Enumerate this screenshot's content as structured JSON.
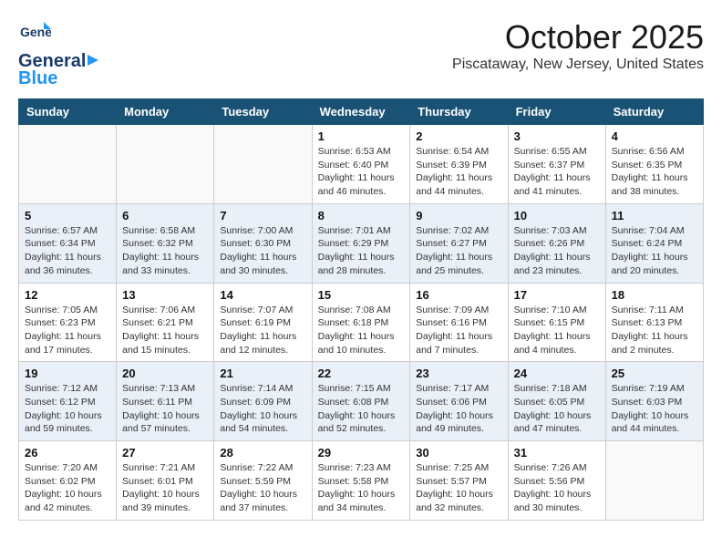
{
  "header": {
    "logo_line1": "General",
    "logo_line2": "Blue",
    "month_title": "October 2025",
    "location": "Piscataway, New Jersey, United States"
  },
  "weekdays": [
    "Sunday",
    "Monday",
    "Tuesday",
    "Wednesday",
    "Thursday",
    "Friday",
    "Saturday"
  ],
  "weeks": [
    [
      {
        "day": "",
        "info": ""
      },
      {
        "day": "",
        "info": ""
      },
      {
        "day": "",
        "info": ""
      },
      {
        "day": "1",
        "info": "Sunrise: 6:53 AM\nSunset: 6:40 PM\nDaylight: 11 hours\nand 46 minutes."
      },
      {
        "day": "2",
        "info": "Sunrise: 6:54 AM\nSunset: 6:39 PM\nDaylight: 11 hours\nand 44 minutes."
      },
      {
        "day": "3",
        "info": "Sunrise: 6:55 AM\nSunset: 6:37 PM\nDaylight: 11 hours\nand 41 minutes."
      },
      {
        "day": "4",
        "info": "Sunrise: 6:56 AM\nSunset: 6:35 PM\nDaylight: 11 hours\nand 38 minutes."
      }
    ],
    [
      {
        "day": "5",
        "info": "Sunrise: 6:57 AM\nSunset: 6:34 PM\nDaylight: 11 hours\nand 36 minutes."
      },
      {
        "day": "6",
        "info": "Sunrise: 6:58 AM\nSunset: 6:32 PM\nDaylight: 11 hours\nand 33 minutes."
      },
      {
        "day": "7",
        "info": "Sunrise: 7:00 AM\nSunset: 6:30 PM\nDaylight: 11 hours\nand 30 minutes."
      },
      {
        "day": "8",
        "info": "Sunrise: 7:01 AM\nSunset: 6:29 PM\nDaylight: 11 hours\nand 28 minutes."
      },
      {
        "day": "9",
        "info": "Sunrise: 7:02 AM\nSunset: 6:27 PM\nDaylight: 11 hours\nand 25 minutes."
      },
      {
        "day": "10",
        "info": "Sunrise: 7:03 AM\nSunset: 6:26 PM\nDaylight: 11 hours\nand 23 minutes."
      },
      {
        "day": "11",
        "info": "Sunrise: 7:04 AM\nSunset: 6:24 PM\nDaylight: 11 hours\nand 20 minutes."
      }
    ],
    [
      {
        "day": "12",
        "info": "Sunrise: 7:05 AM\nSunset: 6:23 PM\nDaylight: 11 hours\nand 17 minutes."
      },
      {
        "day": "13",
        "info": "Sunrise: 7:06 AM\nSunset: 6:21 PM\nDaylight: 11 hours\nand 15 minutes."
      },
      {
        "day": "14",
        "info": "Sunrise: 7:07 AM\nSunset: 6:19 PM\nDaylight: 11 hours\nand 12 minutes."
      },
      {
        "day": "15",
        "info": "Sunrise: 7:08 AM\nSunset: 6:18 PM\nDaylight: 11 hours\nand 10 minutes."
      },
      {
        "day": "16",
        "info": "Sunrise: 7:09 AM\nSunset: 6:16 PM\nDaylight: 11 hours\nand 7 minutes."
      },
      {
        "day": "17",
        "info": "Sunrise: 7:10 AM\nSunset: 6:15 PM\nDaylight: 11 hours\nand 4 minutes."
      },
      {
        "day": "18",
        "info": "Sunrise: 7:11 AM\nSunset: 6:13 PM\nDaylight: 11 hours\nand 2 minutes."
      }
    ],
    [
      {
        "day": "19",
        "info": "Sunrise: 7:12 AM\nSunset: 6:12 PM\nDaylight: 10 hours\nand 59 minutes."
      },
      {
        "day": "20",
        "info": "Sunrise: 7:13 AM\nSunset: 6:11 PM\nDaylight: 10 hours\nand 57 minutes."
      },
      {
        "day": "21",
        "info": "Sunrise: 7:14 AM\nSunset: 6:09 PM\nDaylight: 10 hours\nand 54 minutes."
      },
      {
        "day": "22",
        "info": "Sunrise: 7:15 AM\nSunset: 6:08 PM\nDaylight: 10 hours\nand 52 minutes."
      },
      {
        "day": "23",
        "info": "Sunrise: 7:17 AM\nSunset: 6:06 PM\nDaylight: 10 hours\nand 49 minutes."
      },
      {
        "day": "24",
        "info": "Sunrise: 7:18 AM\nSunset: 6:05 PM\nDaylight: 10 hours\nand 47 minutes."
      },
      {
        "day": "25",
        "info": "Sunrise: 7:19 AM\nSunset: 6:03 PM\nDaylight: 10 hours\nand 44 minutes."
      }
    ],
    [
      {
        "day": "26",
        "info": "Sunrise: 7:20 AM\nSunset: 6:02 PM\nDaylight: 10 hours\nand 42 minutes."
      },
      {
        "day": "27",
        "info": "Sunrise: 7:21 AM\nSunset: 6:01 PM\nDaylight: 10 hours\nand 39 minutes."
      },
      {
        "day": "28",
        "info": "Sunrise: 7:22 AM\nSunset: 5:59 PM\nDaylight: 10 hours\nand 37 minutes."
      },
      {
        "day": "29",
        "info": "Sunrise: 7:23 AM\nSunset: 5:58 PM\nDaylight: 10 hours\nand 34 minutes."
      },
      {
        "day": "30",
        "info": "Sunrise: 7:25 AM\nSunset: 5:57 PM\nDaylight: 10 hours\nand 32 minutes."
      },
      {
        "day": "31",
        "info": "Sunrise: 7:26 AM\nSunset: 5:56 PM\nDaylight: 10 hours\nand 30 minutes."
      },
      {
        "day": "",
        "info": ""
      }
    ]
  ]
}
